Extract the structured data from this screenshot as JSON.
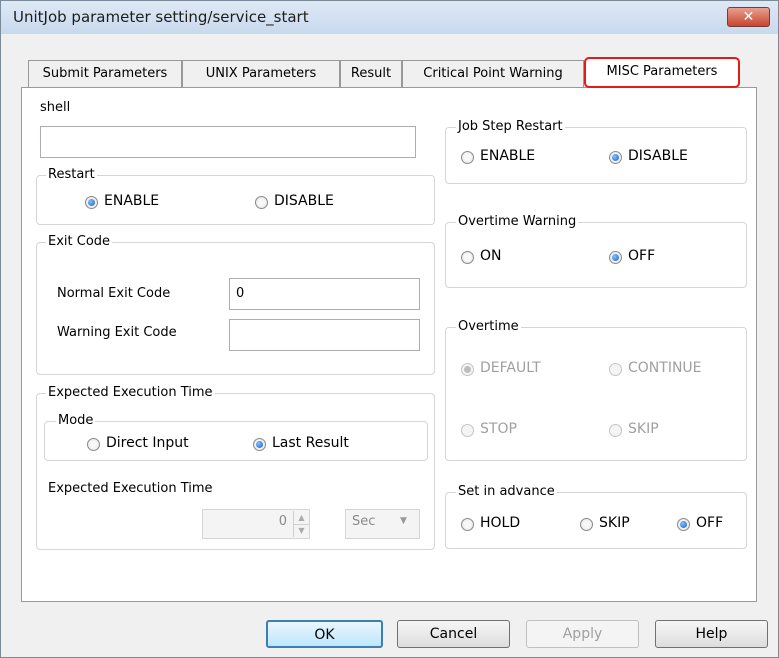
{
  "window": {
    "title": "UnitJob parameter setting/service_start",
    "close_label": "✕"
  },
  "tabs": [
    {
      "label": "Submit Parameters"
    },
    {
      "label": "UNIX Parameters"
    },
    {
      "label": "Result"
    },
    {
      "label": "Critical Point Warning"
    },
    {
      "label": "MISC Parameters",
      "active": true
    }
  ],
  "shell": {
    "label": "shell",
    "value": ""
  },
  "restart": {
    "title": "Restart",
    "options": [
      {
        "label": "ENABLE",
        "selected": true
      },
      {
        "label": "DISABLE",
        "selected": false
      }
    ]
  },
  "exit_code": {
    "title": "Exit Code",
    "normal_label": "Normal Exit Code",
    "normal_value": "0",
    "warning_label": "Warning Exit Code",
    "warning_value": ""
  },
  "expected_time": {
    "title": "Expected Execution Time",
    "mode_title": "Mode",
    "mode_options": [
      {
        "label": "Direct Input",
        "selected": false
      },
      {
        "label": "Last Result",
        "selected": true
      }
    ],
    "time_label": "Expected Execution Time",
    "time_value": "0",
    "unit_value": "Sec"
  },
  "job_step_restart": {
    "title": "Job Step Restart",
    "options": [
      {
        "label": "ENABLE",
        "selected": false
      },
      {
        "label": "DISABLE",
        "selected": true
      }
    ]
  },
  "overtime_warning": {
    "title": "Overtime Warning",
    "options": [
      {
        "label": "ON",
        "selected": false
      },
      {
        "label": "OFF",
        "selected": true
      }
    ]
  },
  "overtime": {
    "title": "Overtime",
    "options": [
      {
        "label": "DEFAULT",
        "selected": true
      },
      {
        "label": "CONTINUE",
        "selected": false
      },
      {
        "label": "STOP",
        "selected": false
      },
      {
        "label": "SKIP",
        "selected": false
      }
    ]
  },
  "set_in_advance": {
    "title": "Set in advance",
    "options": [
      {
        "label": "HOLD",
        "selected": false
      },
      {
        "label": "SKIP",
        "selected": false
      },
      {
        "label": "OFF",
        "selected": true
      }
    ]
  },
  "buttons": {
    "ok": "OK",
    "cancel": "Cancel",
    "apply": "Apply",
    "help": "Help"
  }
}
